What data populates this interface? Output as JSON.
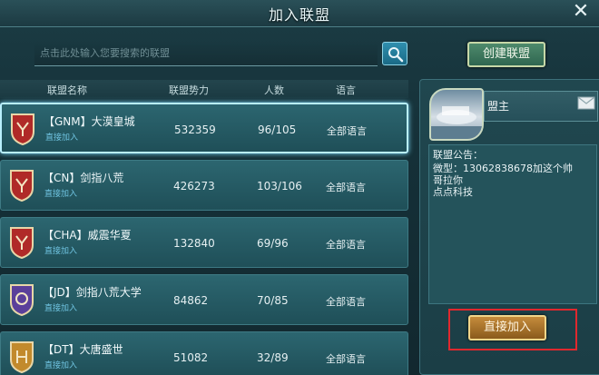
{
  "window": {
    "title": "加入联盟",
    "close_symbol": "✕"
  },
  "search": {
    "placeholder": "点击此处输入您要搜索的联盟"
  },
  "create_button": "创建联盟",
  "table": {
    "headers": [
      "联盟名称",
      "联盟势力",
      "人数",
      "语言"
    ],
    "rows": [
      {
        "name": "【GNM】大漠皇城",
        "join": "直接加入",
        "power": "532359",
        "members": "96/105",
        "language": "全部语言",
        "emblem_color": "#b02a28"
      },
      {
        "name": "【CN】剑指八荒",
        "join": "直接加入",
        "power": "426273",
        "members": "103/106",
        "language": "全部语言",
        "emblem_color": "#b02a28"
      },
      {
        "name": "【CHA】威震华夏",
        "join": "直接加入",
        "power": "132840",
        "members": "69/96",
        "language": "全部语言",
        "emblem_color": "#b02a28"
      },
      {
        "name": "【JD】剑指八荒大学",
        "join": "直接加入",
        "power": "84862",
        "members": "70/85",
        "language": "全部语言",
        "emblem_color": "#5b3f9a"
      },
      {
        "name": "【DT】大唐盛世",
        "join": "直接加入",
        "power": "51082",
        "members": "32/89",
        "language": "全部语言",
        "emblem_color": "#c28a2c"
      }
    ]
  },
  "detail": {
    "leader_label": "盟主",
    "notice_title": "联盟公告：",
    "notice_lines": [
      "微型：13062838678加这个帅",
      "哥拉你",
      "点点科技"
    ],
    "direct_join_button": "直接加入"
  },
  "colors": {
    "highlight": "#e0282e",
    "selected_border": "#b9f0ff"
  }
}
